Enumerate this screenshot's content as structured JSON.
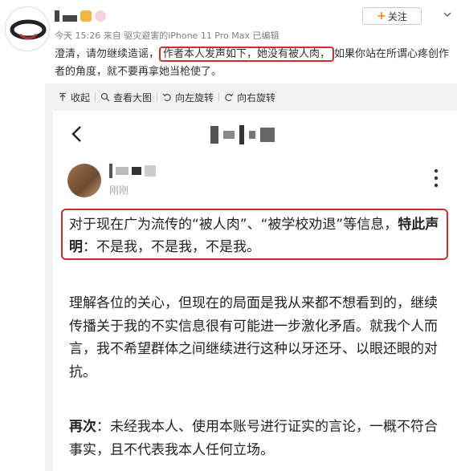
{
  "post": {
    "follow_label": "关注",
    "follow_plus": "+",
    "meta": "今天 15:26 来自 驱灾避害的iPhone 11 Pro Max  已编辑",
    "text_before": "澄清，请勿继续造谣，",
    "text_highlight": "作者本人发声如下，她没有被人肉，",
    "text_after": "如果你站在所谓心疼创作者的角度，就不要再拿她当枪使了。"
  },
  "toolbar": {
    "collapse": "收起",
    "view_large": "查看大图",
    "rotate_left": "向左旋转",
    "rotate_right": "向右旋转"
  },
  "screenshot": {
    "time": "刚刚",
    "statement_part1": "对于现在广为流传的“被人肉”、“被学校劝退”等信息，",
    "statement_bold": "特此声明",
    "statement_part2": "：不是我，不是我，不是我。",
    "paragraph1": "理解各位的关心，但现在的局面是我从来都不想看到的，继续传播关于我的不实信息很有可能进一步激化矛盾。就我个人而言，我不希望群体之间继续进行这种以牙还牙、以眼还眼的对抗。",
    "p2_bold": "再次",
    "p2_rest": "：未经我本人、使用本账号进行证实的言论，一概不符合事实，且不代表我本人任何立场。"
  },
  "colors": {
    "highlight_border": "#c9302c",
    "follow_plus": "#ff8200",
    "meta_gray": "#808080",
    "panel_bg": "#f2f2f2"
  },
  "icons": [
    "avatar-ring-icon",
    "crown-badge-icon",
    "rabbit-badge-icon",
    "chevron-down-icon",
    "collapse-icon",
    "magnifier-icon",
    "rotate-left-icon",
    "rotate-right-icon",
    "back-arrow-icon",
    "more-vertical-icon"
  ]
}
